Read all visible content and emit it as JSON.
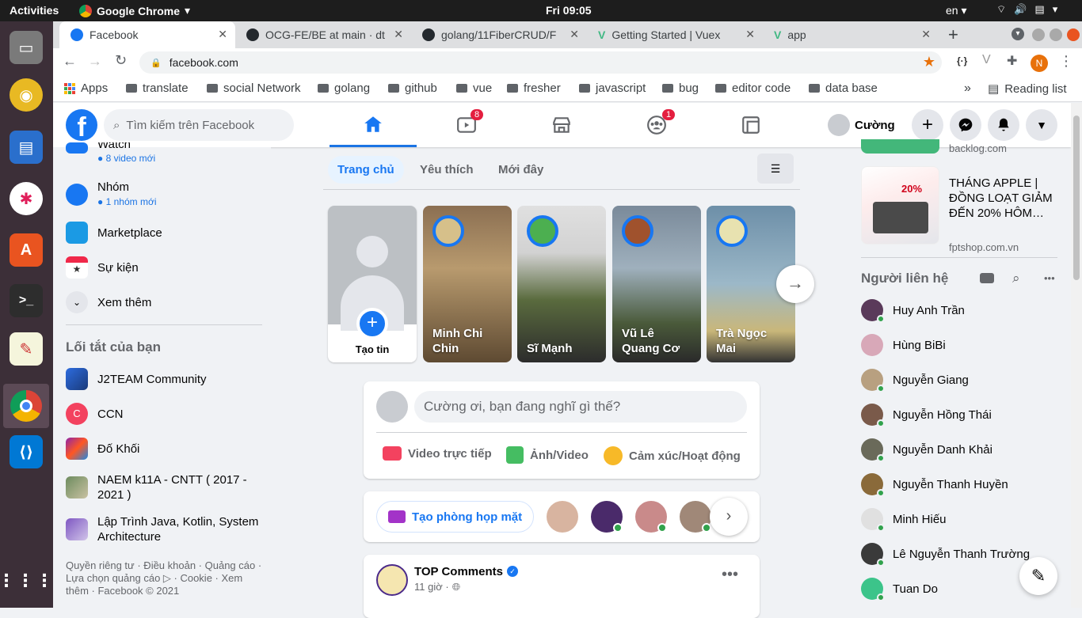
{
  "system": {
    "activities": "Activities",
    "app": "Google Chrome",
    "clock": "Fri 09:05",
    "lang": "en"
  },
  "tabs": [
    {
      "label": "Facebook",
      "active": true
    },
    {
      "label": "OCG-FE/BE at main · dt"
    },
    {
      "label": "golang/11FiberCRUD/F"
    },
    {
      "label": "Getting Started | Vuex"
    },
    {
      "label": "app"
    }
  ],
  "toolbar": {
    "url": "facebook.com",
    "profile_initial": "N"
  },
  "bookmarks": [
    "Apps",
    "translate",
    "social Network",
    "golang",
    "github",
    "vue",
    "fresher",
    "javascript",
    "bug",
    "editor code",
    "data base"
  ],
  "bookmarks_more": "»",
  "reading_list": "Reading list",
  "fb": {
    "search_placeholder": "Tìm kiếm trên Facebook",
    "badges": {
      "watch": "8",
      "groups": "1"
    },
    "user": "Cường",
    "left": {
      "watch_label": "Watch",
      "watch_sub": "8 video mới",
      "groups_label": "Nhóm",
      "groups_sub": "1 nhóm mới",
      "marketplace": "Marketplace",
      "events": "Sự kiện",
      "see_more": "Xem thêm",
      "shortcuts_title": "Lối tắt của bạn",
      "shortcuts": [
        "J2TEAM Community",
        "CCN",
        "Đố Khối",
        "NAEM k11A - CNTT ( 2017 - 2021 )",
        "Lập Trình Java, Kotlin, System Architecture"
      ],
      "ccn_initial": "C",
      "footer": "Quyền riêng tư · Điều khoản · Quảng cáo · Lựa chọn quảng cáo ▷ · Cookie · Xem thêm · Facebook © 2021"
    },
    "feed_tabs": [
      "Trang chủ",
      "Yêu thích",
      "Mới đây"
    ],
    "stories": [
      {
        "name": "Tạo tin"
      },
      {
        "name": "Minh Chi Chin"
      },
      {
        "name": "Sĩ Mạnh"
      },
      {
        "name": "Vũ Lê Quang Cơ"
      },
      {
        "name": "Trà Ngọc Mai"
      }
    ],
    "composer": {
      "placeholder": "Cường ơi, bạn đang nghĩ gì thế?",
      "live": "Video trực tiếp",
      "photo": "Ảnh/Video",
      "feeling": "Cảm xúc/Hoạt động"
    },
    "rooms": {
      "label": "Tạo phòng họp mặt"
    },
    "post": {
      "author": "TOP Comments",
      "time": "11 giờ ·"
    },
    "right": {
      "ad_domain_prev": "backlog.com",
      "ad_title": "THÁNG APPLE | ĐỒNG LOẠT GIẢM ĐẾN 20% HÔM…",
      "ad_domain": "fptshop.com.vn",
      "ad_percent": "20%",
      "contacts_title": "Người liên hệ",
      "contacts": [
        "Huy Anh Trần",
        "Hùng BiBi",
        "Nguyễn Giang",
        "Nguyễn Hồng Thái",
        "Nguyễn Danh Khải",
        "Nguyễn Thanh Huyền",
        "Minh Hiếu",
        "Lê Nguyễn Thanh Trường",
        "Tuan Do"
      ]
    }
  },
  "colors": {
    "fb_blue": "#1877f2",
    "online": "#31a24c",
    "badge": "#e41e3f"
  }
}
